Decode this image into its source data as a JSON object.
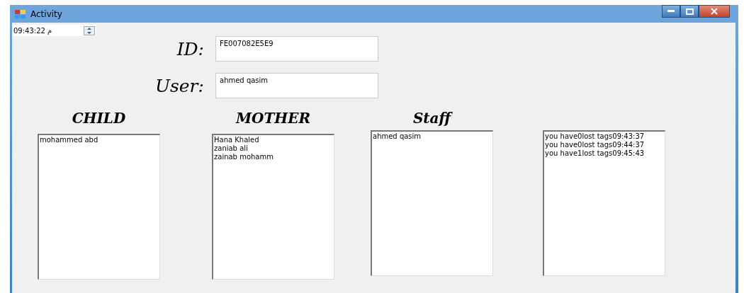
{
  "window": {
    "title": "Activity"
  },
  "time_picker": {
    "value": "09:43:22 م"
  },
  "id_field": {
    "label": "ID:",
    "value": "FE007082E5E9"
  },
  "user_field": {
    "label": "User:",
    "value": "ahmed qasim"
  },
  "lists": [
    {
      "heading": "CHILD",
      "items": [
        "mohammed abd"
      ]
    },
    {
      "heading": "MOTHER",
      "items": [
        "Hana Khaled",
        "zaniab ali",
        "zainab mohamm"
      ]
    },
    {
      "heading": "Staff",
      "items": [
        "ahmed qasim"
      ]
    },
    {
      "items": [
        "you have0lost tags09:43:37",
        "you have0lost tags09:44:37",
        "you have1lost tags09:45:43"
      ]
    }
  ]
}
